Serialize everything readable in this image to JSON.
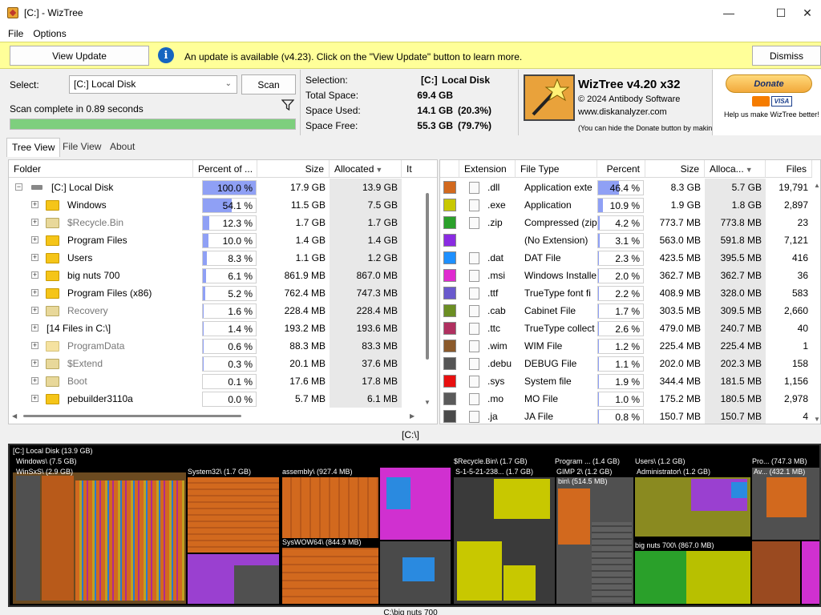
{
  "window": {
    "title": "[C:]  - WizTree",
    "minimize": "—",
    "maximize": "☐",
    "close": "✕"
  },
  "menu": [
    "File",
    "Options"
  ],
  "update": {
    "button": "View Update",
    "message": "An update is available (v4.23). Click on the \"View Update\" button to learn more.",
    "dismiss": "Dismiss",
    "icon": "info-icon"
  },
  "scan": {
    "select_label": "Select:",
    "drive": "[C:] Local Disk",
    "scan_button": "Scan",
    "status": "Scan complete in 0.89 seconds",
    "progress": 1.0
  },
  "selection": {
    "label": "Selection:",
    "drive": "[C:]",
    "name": "Local Disk",
    "total_label": "Total Space:",
    "total": "69.4 GB",
    "used_label": "Space Used:",
    "used": "14.1 GB",
    "used_pct": "(20.3%)",
    "free_label": "Space Free:",
    "free": "55.3 GB",
    "free_pct": "(79.7%)"
  },
  "about": {
    "name": "WizTree v4.20 x32",
    "copyright": "© 2024 Antibody Software",
    "site": "www.diskanalyzer.com",
    "note": "(You can hide the Donate button by making a donation)"
  },
  "donate": {
    "button": "Donate",
    "cards": "VISA",
    "caption": "Help us make WizTree better!"
  },
  "tabs": [
    "Tree View",
    "File View",
    "About"
  ],
  "tree": {
    "headers": {
      "folder": "Folder",
      "percent": "Percent of ...",
      "size": "Size",
      "allocated": "Allocated",
      "items": "It"
    },
    "rows": [
      {
        "name": "[C:] Local Disk",
        "pct": "100.0 %",
        "frac": 1.0,
        "size": "17.9 GB",
        "alloc": "13.9 GB",
        "level": 0,
        "kind": "drive"
      },
      {
        "name": "Windows",
        "pct": "54.1 %",
        "frac": 0.541,
        "size": "11.5 GB",
        "alloc": "7.5 GB",
        "level": 1,
        "kind": "folder"
      },
      {
        "name": "$Recycle.Bin",
        "pct": "12.3 %",
        "frac": 0.123,
        "size": "1.7 GB",
        "alloc": "1.7 GB",
        "level": 1,
        "kind": "sys"
      },
      {
        "name": "Program Files",
        "pct": "10.0 %",
        "frac": 0.1,
        "size": "1.4 GB",
        "alloc": "1.4 GB",
        "level": 1,
        "kind": "folder"
      },
      {
        "name": "Users",
        "pct": "8.3 %",
        "frac": 0.083,
        "size": "1.1 GB",
        "alloc": "1.2 GB",
        "level": 1,
        "kind": "folder"
      },
      {
        "name": "big nuts 700",
        "pct": "6.1 %",
        "frac": 0.061,
        "size": "861.9 MB",
        "alloc": "867.0 MB",
        "level": 1,
        "kind": "folder"
      },
      {
        "name": "Program Files (x86)",
        "pct": "5.2 %",
        "frac": 0.052,
        "size": "762.4 MB",
        "alloc": "747.3 MB",
        "level": 1,
        "kind": "folder"
      },
      {
        "name": "Recovery",
        "pct": "1.6 %",
        "frac": 0.016,
        "size": "228.4 MB",
        "alloc": "228.4 MB",
        "level": 1,
        "kind": "sys"
      },
      {
        "name": "[14 Files in C:\\]",
        "pct": "1.4 %",
        "frac": 0.014,
        "size": "193.2 MB",
        "alloc": "193.6 MB",
        "level": 1,
        "kind": "files"
      },
      {
        "name": "ProgramData",
        "pct": "0.6 %",
        "frac": 0.006,
        "size": "88.3 MB",
        "alloc": "83.3 MB",
        "level": 1,
        "kind": "pale"
      },
      {
        "name": "$Extend",
        "pct": "0.3 %",
        "frac": 0.003,
        "size": "20.1 MB",
        "alloc": "37.6 MB",
        "level": 1,
        "kind": "sys"
      },
      {
        "name": "Boot",
        "pct": "0.1 %",
        "frac": 0.001,
        "size": "17.6 MB",
        "alloc": "17.8 MB",
        "level": 1,
        "kind": "sys"
      },
      {
        "name": "pebuilder3110a",
        "pct": "0.0 %",
        "frac": 0.0,
        "size": "5.7 MB",
        "alloc": "6.1 MB",
        "level": 1,
        "kind": "folder"
      }
    ]
  },
  "extensions": {
    "headers": {
      "ext": "Extension",
      "type": "File Type",
      "percent": "Percent",
      "size": "Size",
      "alloc": "Alloca...",
      "files": "Files"
    },
    "rows": [
      {
        "color": "#d2691e",
        "ext": ".dll",
        "type": "Application exte",
        "pct": "46.4 %",
        "frac": 0.464,
        "size": "8.3 GB",
        "alloc": "5.7 GB",
        "files": "19,791"
      },
      {
        "color": "#c8c800",
        "ext": ".exe",
        "type": "Application",
        "pct": "10.9 %",
        "frac": 0.109,
        "size": "1.9 GB",
        "alloc": "1.8 GB",
        "files": "2,897"
      },
      {
        "color": "#2aa02a",
        "ext": ".zip",
        "type": "Compressed (zip",
        "pct": "4.2 %",
        "frac": 0.042,
        "size": "773.7 MB",
        "alloc": "773.8 MB",
        "files": "23"
      },
      {
        "color": "#8a2be2",
        "ext": "",
        "type": "(No Extension)",
        "pct": "3.1 %",
        "frac": 0.031,
        "size": "563.0 MB",
        "alloc": "591.8 MB",
        "files": "7,121"
      },
      {
        "color": "#1e90ff",
        "ext": ".dat",
        "type": "DAT File",
        "pct": "2.3 %",
        "frac": 0.023,
        "size": "423.5 MB",
        "alloc": "395.5 MB",
        "files": "416"
      },
      {
        "color": "#e02ad0",
        "ext": ".msi",
        "type": "Windows Installe",
        "pct": "2.0 %",
        "frac": 0.02,
        "size": "362.7 MB",
        "alloc": "362.7 MB",
        "files": "36"
      },
      {
        "color": "#6a5acd",
        "ext": ".ttf",
        "type": "TrueType font fi",
        "pct": "2.2 %",
        "frac": 0.022,
        "size": "408.9 MB",
        "alloc": "328.0 MB",
        "files": "583"
      },
      {
        "color": "#6b8e23",
        "ext": ".cab",
        "type": "Cabinet File",
        "pct": "1.7 %",
        "frac": 0.017,
        "size": "303.5 MB",
        "alloc": "309.5 MB",
        "files": "2,660"
      },
      {
        "color": "#b03060",
        "ext": ".ttc",
        "type": "TrueType collect",
        "pct": "2.6 %",
        "frac": 0.026,
        "size": "479.0 MB",
        "alloc": "240.7 MB",
        "files": "40"
      },
      {
        "color": "#8b5a2b",
        "ext": ".wim",
        "type": "WIM File",
        "pct": "1.2 %",
        "frac": 0.012,
        "size": "225.4 MB",
        "alloc": "225.4 MB",
        "files": "1"
      },
      {
        "color": "#555555",
        "ext": ".debu",
        "type": "DEBUG File",
        "pct": "1.1 %",
        "frac": 0.011,
        "size": "202.0 MB",
        "alloc": "202.3 MB",
        "files": "158"
      },
      {
        "color": "#e81010",
        "ext": ".sys",
        "type": "System file",
        "pct": "1.9 %",
        "frac": 0.019,
        "size": "344.4 MB",
        "alloc": "181.5 MB",
        "files": "1,156"
      },
      {
        "color": "#5a5a5a",
        "ext": ".mo",
        "type": "MO File",
        "pct": "1.0 %",
        "frac": 0.01,
        "size": "175.2 MB",
        "alloc": "180.5 MB",
        "files": "2,978"
      },
      {
        "color": "#4a4a4a",
        "ext": ".ja",
        "type": "JA File",
        "pct": "0.8 %",
        "frac": 0.008,
        "size": "150.7 MB",
        "alloc": "150.7 MB",
        "files": "4"
      }
    ]
  },
  "treemap": {
    "path": "[C:\\]",
    "footer": "C:\\big nuts 700",
    "labels": {
      "root": "[C:] Local Disk (13.9 GB)",
      "windows": "Windows\\ (7.5 GB)",
      "winsxs": "WinSxS\\ (2.9 GB)",
      "system32": "System32\\ (1.7 GB)",
      "assembly": "assembly\\ (927.4 MB)",
      "syswow64": "SysWOW64\\ (844.9 MB)",
      "recycle": "$Recycle.Bin\\ (1.7 GB)",
      "sid": "S-1-5-21-238... (1.7 GB)",
      "progfiles": "Program ... (1.4 GB)",
      "gimp": "GIMP 2\\ (1.2 GB)",
      "bin": "bin\\ (514.5 MB)",
      "users": "Users\\ (1.2 GB)",
      "admin": "Administrator\\ (1.2 GB)",
      "bignuts": "big nuts 700\\ (867.0 MB)",
      "pro": "Pro... (747.3 MB)",
      "av": "Av... (432.1 MB)"
    }
  }
}
